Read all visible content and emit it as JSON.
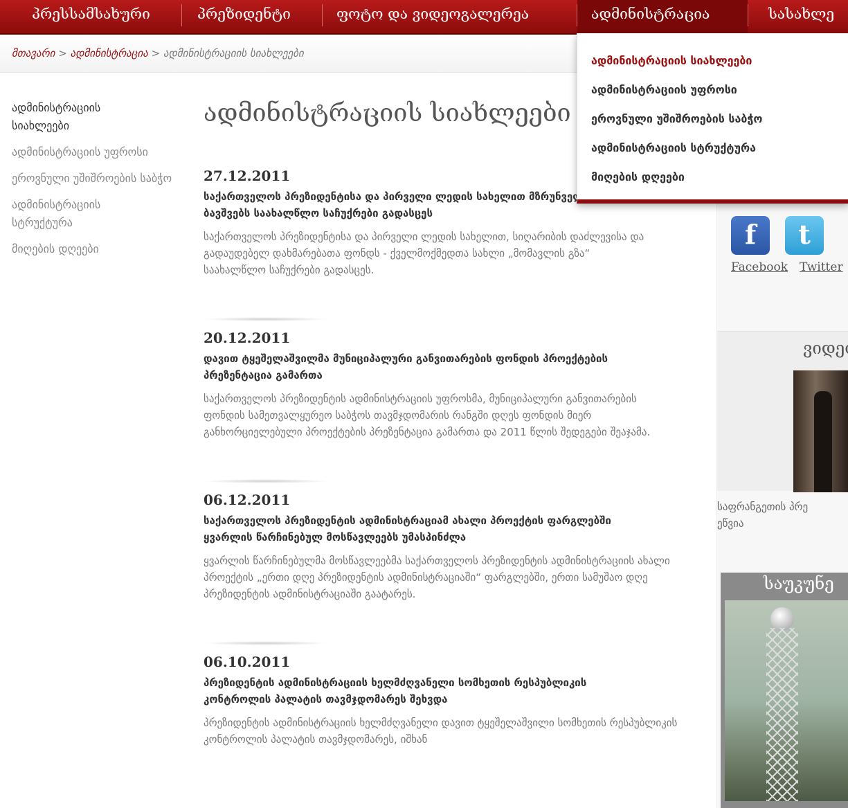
{
  "nav": {
    "items": [
      {
        "label": "პრესსამსახური"
      },
      {
        "label": "პრეზიდენტი"
      },
      {
        "label": "ფოტო და ვიდეოგალერეა"
      },
      {
        "label": "ადმინისტრაცია"
      },
      {
        "label": "სასახლე"
      }
    ]
  },
  "breadcrumb": {
    "home": "მთავარი",
    "separator": ">",
    "section": "ადმინისტრაცია",
    "current": "ადმინისტრაციის სიახლეები"
  },
  "sidebar": {
    "items": [
      {
        "label": "ადმინისტრაციის სიახლეები"
      },
      {
        "label": "ადმინისტრაციის უფროსი"
      },
      {
        "label": "ეროვნული უშიშროების საბჭო"
      },
      {
        "label": "ადმინისტრაციის სტრუქტურა"
      },
      {
        "label": "მიღების დღეები"
      }
    ]
  },
  "main": {
    "title": "ადმინისტრაციის სიახლეები",
    "news": [
      {
        "date": "27.12.2011",
        "headline": "საქართველოს პრეზიდენტისა და პირველი ლედის სახელით მზრუნველობამოკლებულ ბავშვებს საახალწლო საჩუქრები გადასცეს",
        "summary": "საქართველოს პრეზიდენტისა და პირველი ლედის სახელით, სიღარიბის დაძლევისა და გადაუდებელ დახმარებათა ფონდს - ქველმოქმედთა სახლი „მომავლის გზა“ საახალწლო საჩუქრები გადასცეს."
      },
      {
        "date": "20.12.2011",
        "headline": "დავით ტყეშელაშვილმა მუნიციპალური განვითარების ფონდის პროექტების პრეზენტაცია გამართა",
        "summary": "საქართველოს პრეზიდენტის ადმინისტრაციის უფროსმა, მუნიციპალური განვითარების ფონდის სამეთვალყურეო საბჭოს თავმჯდომარის რანგში დღეს ფონდის მიერ განხორციელებული პროექტების პრეზენტაცია გამართა და 2011 წლის შედეგები შეაჯამა."
      },
      {
        "date": "06.12.2011",
        "headline": "საქართველოს პრეზიდენტის ადმინისტრაციამ ახალი პროექტის ფარგლებში ყვარლის წარჩინებულ მოსწავლეებს უმასპინძლა",
        "summary": "ყვარლის წარჩინებულმა მოსწავლეებმა საქართველოს პრეზიდენტის ადმინისტრაციის ახალი პროექტის „ერთი დღე პრეზიდენტის ადმინისტრაციაში“ ფარგლებში, ერთი სამუშაო დღე პრეზიდენტის ადმინისტრაციაში გაატარეს."
      },
      {
        "date": "06.10.2011",
        "headline": "პრეზიდენტის ადმინისტრაციის ხელმძღვანელი სომხეთის რესპუბლიკის კონტროლის პალატის თავმჯდომარეს შეხვდა",
        "summary": "პრეზიდენტის ადმინისტრაციის ხელმძღვანელი დავით ტყეშელაშვილი სომხეთის რესპუბლიკის კონტროლის პალატის თავმჯდომარეს, იშხან"
      }
    ]
  },
  "dropdown": {
    "items": [
      {
        "label": "ადმინისტრაციის სიახლეები"
      },
      {
        "label": "ადმინისტრაციის უფროსი"
      },
      {
        "label": "ეროვნული უშიშროების საბჭო"
      },
      {
        "label": "ადმინისტრაციის სტრუქტურა"
      },
      {
        "label": "მიღების დღეები"
      }
    ]
  },
  "right": {
    "social": {
      "facebook": "Facebook",
      "twitter": "Twitter",
      "fb_glyph": "f",
      "tw_glyph": "t"
    },
    "video_title": "ვიდეო",
    "video_caption": "საფრანგეთის პრეზიდენტის ვიზიტი ეწვია",
    "video_caption_line1": "საფრანგეთის პრე",
    "video_caption_line2": "ეწვია",
    "centuries_title": "საუკუნე"
  },
  "colors": {
    "accent": "#9a1010",
    "nav_bg": "#a51414"
  }
}
